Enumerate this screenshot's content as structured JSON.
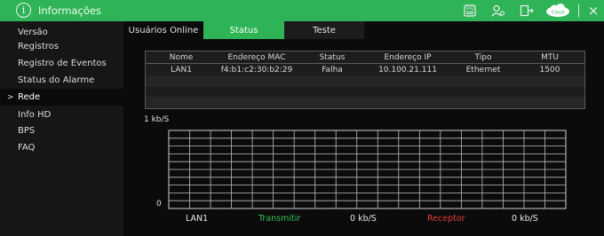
{
  "window": {
    "title": "Informações",
    "icons": [
      "info-icon",
      "faq-icon",
      "users-icon",
      "logout-icon",
      "cloud-icon",
      "close-icon"
    ],
    "cloud_label": "Cloud",
    "close_glyph": "×",
    "accent_color": "#2fb357"
  },
  "sidebar": {
    "items": [
      {
        "label": "Versão"
      },
      {
        "label": "Registros"
      },
      {
        "label": "Registro de Eventos"
      },
      {
        "label": "Status do Alarme"
      },
      {
        "label": "Rede",
        "selected": true,
        "marker": ">"
      },
      {
        "label": "Info HD"
      },
      {
        "label": "BPS"
      },
      {
        "label": "FAQ"
      }
    ]
  },
  "tabs": [
    {
      "label": "Usuários Online"
    },
    {
      "label": "Status",
      "selected": true
    },
    {
      "label": "Teste"
    }
  ],
  "table": {
    "columns": [
      "Nome",
      "Endereço MAC",
      "Status",
      "Endereço IP",
      "Tipo",
      "MTU"
    ],
    "rows": [
      [
        "LAN1",
        "f4:b1:c2:30:b2:29",
        "Falha",
        "10.100.21.111",
        "Ethernet",
        "1500"
      ]
    ]
  },
  "chart_data": {
    "type": "line",
    "ylabel": "1 kb/S",
    "y_min_label": "0",
    "ylim": [
      0,
      1
    ],
    "grid": true,
    "series": [
      {
        "name": "Transmitir",
        "color": "#35c25b",
        "values": []
      },
      {
        "name": "Receptor",
        "color": "#e83b3b",
        "values": []
      }
    ]
  },
  "legend": {
    "interface": "LAN1",
    "transmit_label": "Transmitir",
    "transmit_value": "0 kb/S",
    "receive_label": "Receptor",
    "receive_value": "0 kb/S"
  }
}
